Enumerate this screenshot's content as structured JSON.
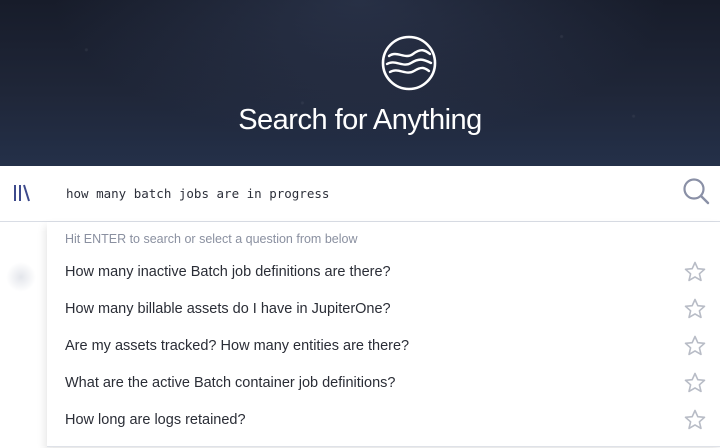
{
  "hero": {
    "title": "Search for Anything",
    "logo_icon": "jupiterone-logo-icon"
  },
  "search": {
    "value": "how many batch jobs are in progress",
    "menu_icon": "library-icon",
    "submit_icon": "search-icon"
  },
  "suggestions": {
    "hint": "Hit ENTER to search or select a question from below",
    "items": [
      {
        "label": "How many inactive Batch job definitions are there?",
        "icon": "star-icon"
      },
      {
        "label": "How many billable assets do I have in JupiterOne?",
        "icon": "star-icon"
      },
      {
        "label": "Are my assets tracked? How many entities are there?",
        "icon": "star-icon"
      },
      {
        "label": "What are the active Batch container job definitions?",
        "icon": "star-icon"
      },
      {
        "label": "How long are logs retained?",
        "icon": "star-icon"
      }
    ]
  },
  "colors": {
    "hero_bg": "#1f2638",
    "icon_blue": "#3d4a8c",
    "star_gray": "#b8bcc6"
  }
}
